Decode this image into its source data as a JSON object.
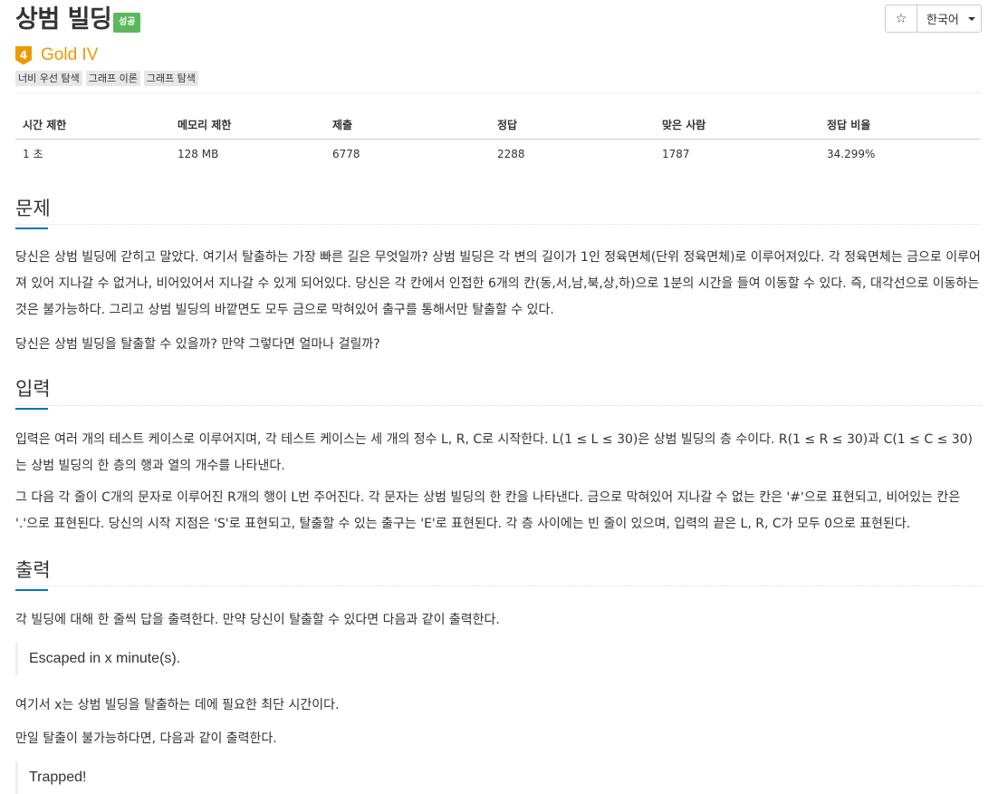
{
  "header": {
    "title": "상범 빌딩",
    "badge": "성공",
    "star_icon": "☆",
    "language": "한국어"
  },
  "tier": {
    "level": "4",
    "name": "Gold IV",
    "color": "#ec9a00"
  },
  "tags": [
    "너비 우선 탐색",
    "그래프 이론",
    "그래프 탐색"
  ],
  "stats_table": {
    "headers": [
      "시간 제한",
      "메모리 제한",
      "제출",
      "정답",
      "맞은 사람",
      "정답 비율"
    ],
    "row": [
      "1 초",
      "128 MB",
      "6778",
      "2288",
      "1787",
      "34.299%"
    ]
  },
  "sections": {
    "problem": {
      "title": "문제",
      "paragraphs": [
        "당신은 상범 빌딩에 갇히고 말았다. 여기서 탈출하는 가장 빠른 길은 무엇일까? 상범 빌딩은 각 변의 길이가 1인 정육면체(단위 정육면체)로 이루어져있다. 각 정육면체는 금으로 이루어져 있어 지나갈 수 없거나, 비어있어서 지나갈 수 있게 되어있다. 당신은 각 칸에서 인접한 6개의 칸(동,서,남,북,상,하)으로 1분의 시간을 들여 이동할 수 있다. 즉, 대각선으로 이동하는 것은 불가능하다. 그리고 상범 빌딩의 바깥면도 모두 금으로 막혀있어 출구를 통해서만 탈출할 수 있다.",
        "당신은 상범 빌딩을 탈출할 수 있을까? 만약 그렇다면 얼마나 걸릴까?"
      ]
    },
    "input": {
      "title": "입력",
      "paragraphs": [
        "입력은 여러 개의 테스트 케이스로 이루어지며, 각 테스트 케이스는 세 개의 정수 L, R, C로 시작한다. L(1 ≤ L ≤ 30)은 상범 빌딩의 층 수이다. R(1 ≤ R ≤ 30)과 C(1 ≤ C ≤ 30)는 상범 빌딩의 한 층의 행과 열의 개수를 나타낸다.",
        "그 다음 각 줄이 C개의 문자로 이루어진 R개의 행이 L번 주어진다. 각 문자는 상범 빌딩의 한 칸을 나타낸다. 금으로 막혀있어 지나갈 수 없는 칸은 '#'으로 표현되고, 비어있는 칸은 '.'으로 표현된다. 당신의 시작 지점은 'S'로 표현되고, 탈출할 수 있는 출구는 'E'로 표현된다. 각 층 사이에는 빈 줄이 있으며, 입력의 끝은 L, R, C가 모두 0으로 표현된다."
      ]
    },
    "output": {
      "title": "출력",
      "p1": "각 빌딩에 대해 한 줄씩 답을 출력한다. 만약 당신이 탈출할 수 있다면 다음과 같이 출력한다.",
      "quote1": "Escaped in x minute(s).",
      "p2": "여기서 x는 상범 빌딩을 탈출하는 데에 필요한 최단 시간이다.",
      "p3": "만일 탈출이 불가능하다면, 다음과 같이 출력한다.",
      "quote2": "Trapped!"
    }
  }
}
